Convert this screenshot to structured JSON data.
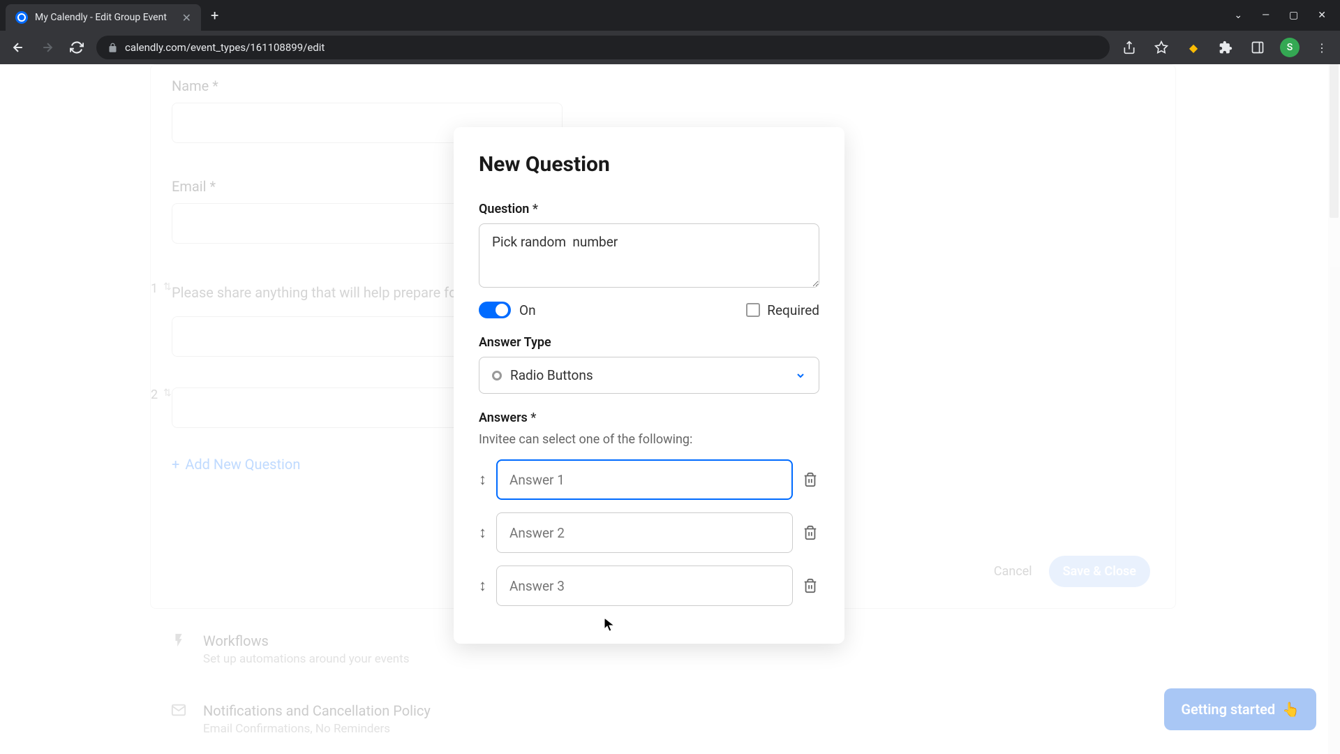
{
  "browser": {
    "tab_title": "My Calendly - Edit Group Event",
    "url": "calendly.com/event_types/161108899/edit",
    "profile_initial": "S"
  },
  "background": {
    "name_label": "Name *",
    "email_label": "Email *",
    "q1_number": "1",
    "q1_text": "Please share anything that will help prepare for our meeting.",
    "q2_number": "2",
    "add_new": "Add New Question",
    "cancel": "Cancel",
    "save": "Save & Close",
    "workflows_title": "Workflows",
    "workflows_sub": "Set up automations around your events",
    "notif_title": "Notifications and Cancellation Policy",
    "notif_sub": "Email Confirmations, No Reminders"
  },
  "modal": {
    "title": "New Question",
    "question_label": "Question",
    "question_value": "Pick random  number",
    "on_label": "On",
    "required_label": "Required",
    "answer_type_label": "Answer Type",
    "answer_type_value": "Radio Buttons",
    "answers_label": "Answers",
    "answers_helper": "Invitee can select one of the following:",
    "answers": [
      {
        "placeholder": "Answer 1"
      },
      {
        "placeholder": "Answer 2"
      },
      {
        "placeholder": "Answer 3"
      }
    ]
  },
  "getting_started": "Getting started",
  "asterisk": "*"
}
